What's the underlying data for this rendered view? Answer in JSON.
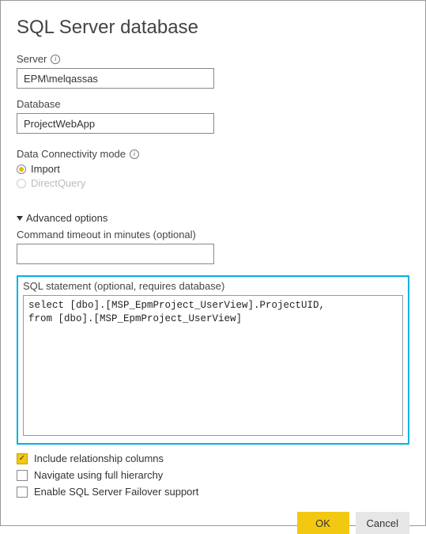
{
  "title": "SQL Server database",
  "server": {
    "label": "Server",
    "value": "EPM\\melqassas"
  },
  "database": {
    "label": "Database",
    "value": "ProjectWebApp"
  },
  "connectivity": {
    "label": "Data Connectivity mode",
    "options": {
      "import": {
        "label": "Import",
        "selected": true,
        "enabled": true
      },
      "directquery": {
        "label": "DirectQuery",
        "selected": false,
        "enabled": false
      }
    }
  },
  "advanced": {
    "header": "Advanced options",
    "timeout_label": "Command timeout in minutes (optional)",
    "timeout_value": "",
    "sql_label": "SQL statement (optional, requires database)",
    "sql_value": "select [dbo].[MSP_EpmProject_UserView].ProjectUID,\nfrom [dbo].[MSP_EpmProject_UserView]",
    "include_relationship": {
      "label": "Include relationship columns",
      "checked": true
    },
    "navigate_full": {
      "label": "Navigate using full hierarchy",
      "checked": false
    },
    "failover": {
      "label": "Enable SQL Server Failover support",
      "checked": false
    }
  },
  "buttons": {
    "ok": "OK",
    "cancel": "Cancel"
  }
}
